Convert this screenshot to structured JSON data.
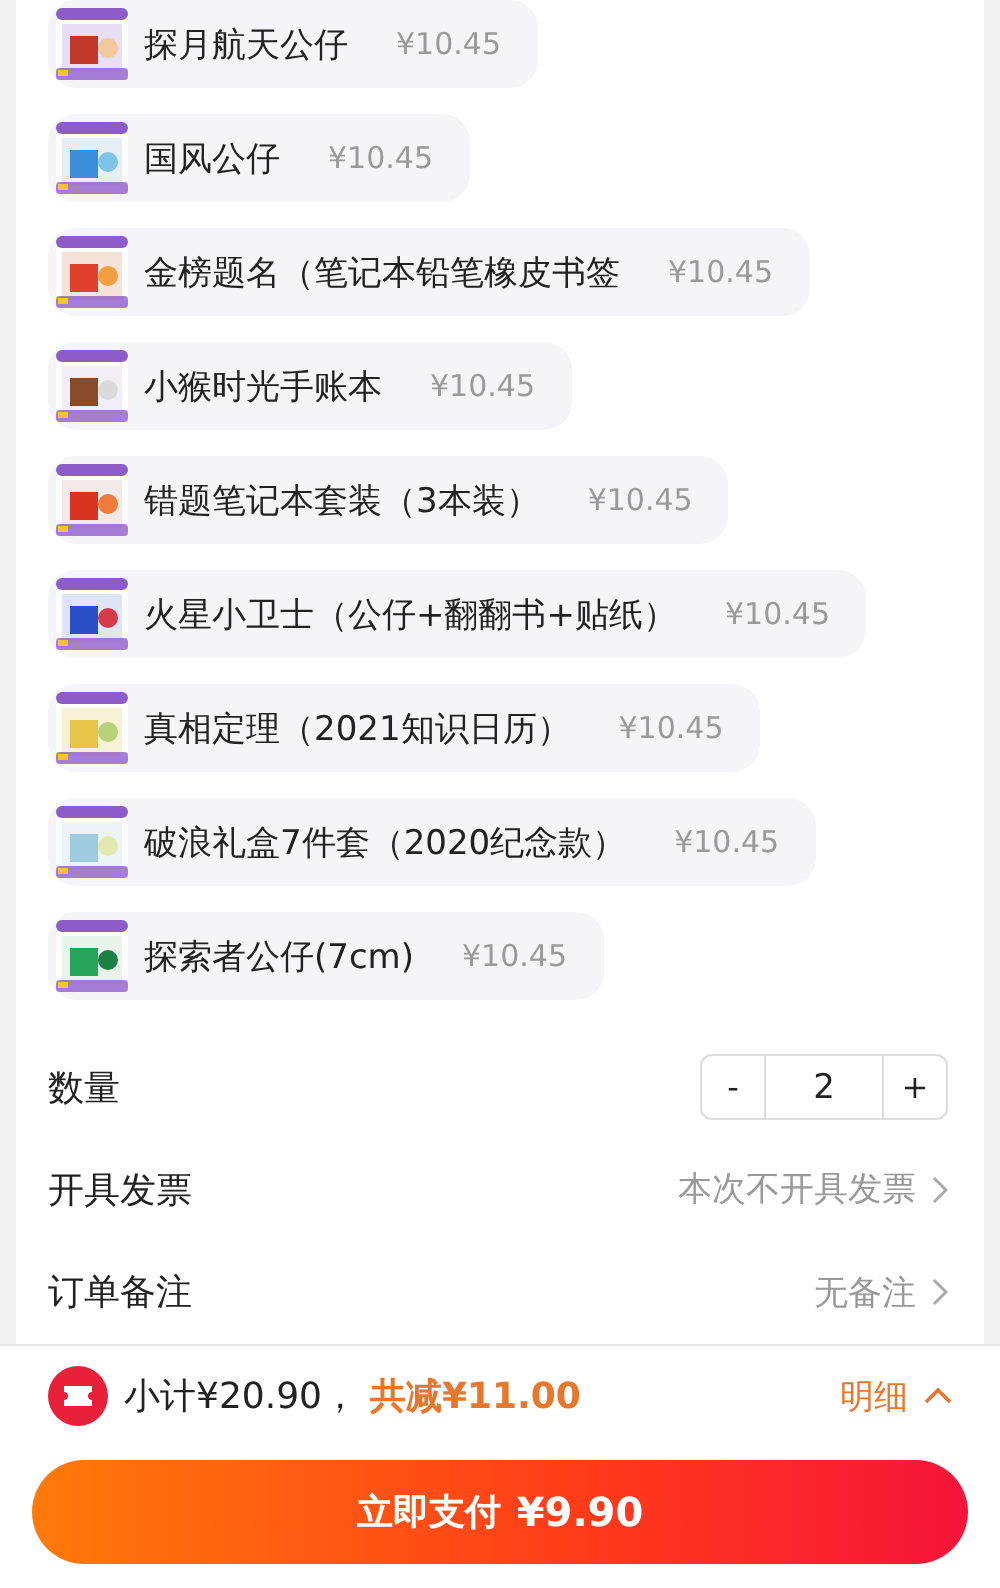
{
  "items": [
    {
      "name": "探月航天公仔",
      "price": "¥10.45"
    },
    {
      "name": "国风公仔",
      "price": "¥10.45"
    },
    {
      "name": "金榜题名（笔记本铅笔橡皮书签",
      "price": "¥10.45"
    },
    {
      "name": "小猴时光手账本",
      "price": "¥10.45"
    },
    {
      "name": "错题笔记本套装（3本装）",
      "price": "¥10.45"
    },
    {
      "name": "火星小卫士（公仔+翻翻书+贴纸）",
      "price": "¥10.45"
    },
    {
      "name": "真相定理（2021知识日历）",
      "price": "¥10.45"
    },
    {
      "name": "破浪礼盒7件套（2020纪念款）",
      "price": "¥10.45"
    },
    {
      "name": "探索者公仔(7cm)",
      "price": "¥10.45"
    }
  ],
  "quantity": {
    "label": "数量",
    "minus": "-",
    "value": "2",
    "plus": "+"
  },
  "rows": [
    {
      "label": "开具发票",
      "value": "本次不开具发票"
    },
    {
      "label": "订单备注",
      "value": "无备注"
    }
  ],
  "summary": {
    "subtotal": "小计¥20.90，",
    "discount": "共减¥11.00",
    "detail": "明细"
  },
  "pay_button": {
    "label": "立即支付",
    "amount": "¥9.90"
  }
}
